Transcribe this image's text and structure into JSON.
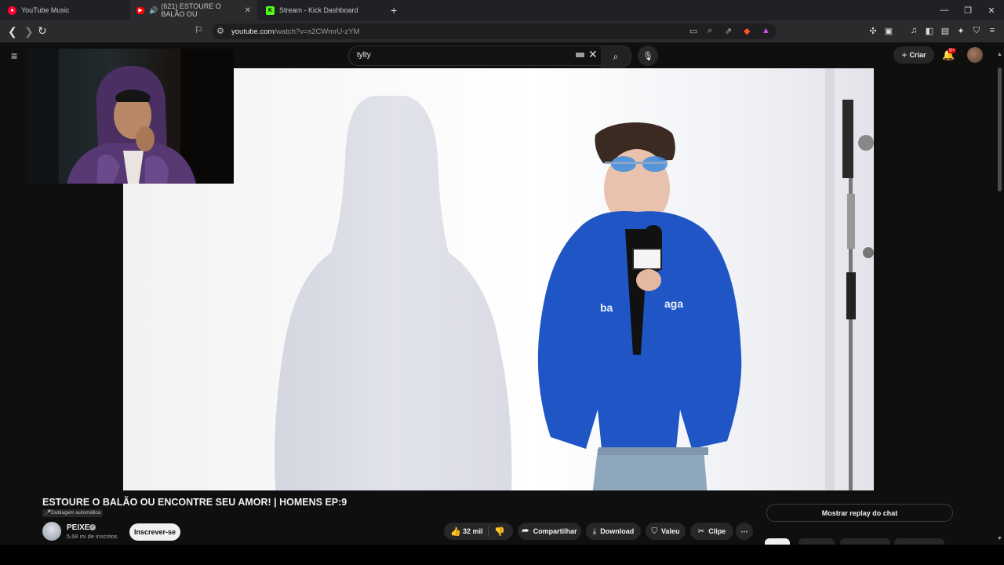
{
  "browser": {
    "tabs": [
      {
        "label": "YouTube Music",
        "active": false
      },
      {
        "label": "(621) ESTOURE O BALÃO OU",
        "active": true
      },
      {
        "label": "Stream - Kick Dashboard",
        "active": false
      }
    ],
    "url_host": "youtube.com",
    "url_path": "/watch?v=s2CWmrU-zYM"
  },
  "header": {
    "search_query": "tylty",
    "create_label": "Criar",
    "notification_count": "9+"
  },
  "video": {
    "title": "ESTOURE O BALÃO OU ENCONTRE SEU AMOR! | HOMENS EP:9",
    "dub_label": "Dublagem automática"
  },
  "channel": {
    "name": "PEIXE",
    "subscribers": "5,68 mi de inscritos",
    "subscribe_label": "Inscrever-se"
  },
  "actions": {
    "likes": "32 mil",
    "share": "Compartilhar",
    "download": "Download",
    "thanks": "Valeu",
    "clip": "Clipe"
  },
  "chat": {
    "replay_label": "Mostrar replay do chat"
  },
  "colors": {
    "background": "#0f0f0f",
    "accent_red": "#cc0000",
    "kick_green": "#53fc18"
  }
}
